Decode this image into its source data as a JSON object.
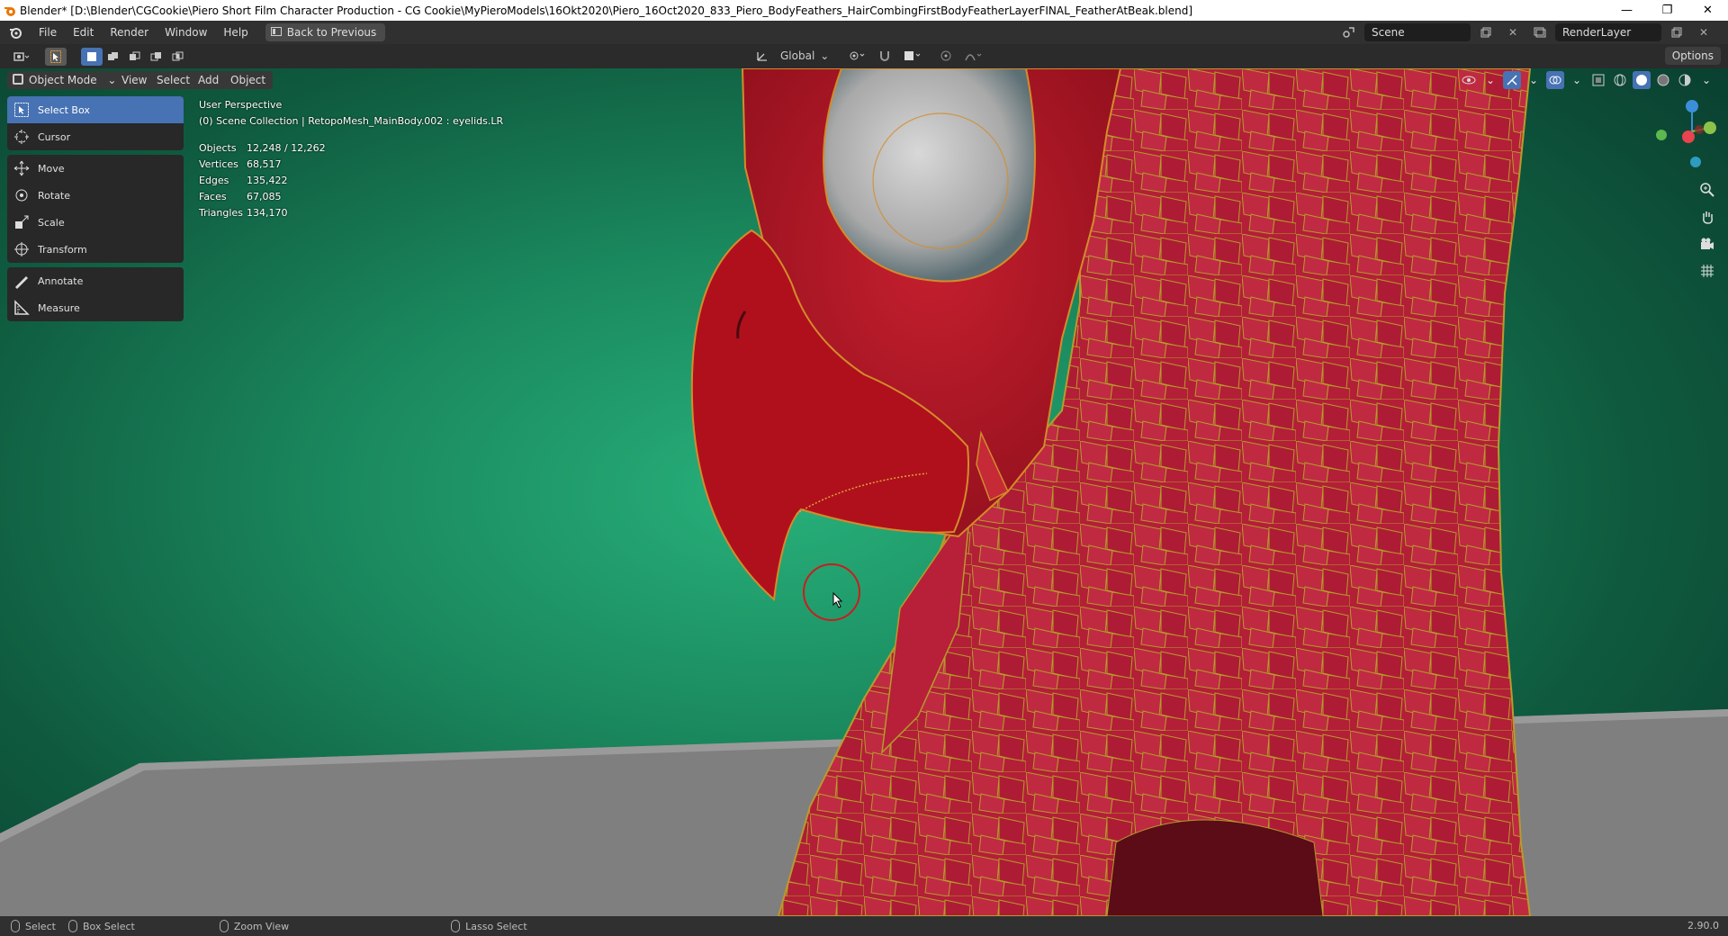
{
  "window": {
    "title": "Blender* [D:\\Blender\\CGCookie\\Piero Short Film Character Production - CG Cookie\\MyPieroModels\\16Okt2020\\Piero_16Oct2020_833_Piero_BodyFeathers_HairCombingFirstBodyFeatherLayerFINAL_FeatherAtBeak.blend]",
    "minimize": "—",
    "restore": "❐",
    "close": "✕"
  },
  "menu": {
    "items": [
      "File",
      "Edit",
      "Render",
      "Window",
      "Help"
    ],
    "back_to_previous": "Back to Previous",
    "scene": "Scene",
    "render_layer": "RenderLayer"
  },
  "header": {
    "orientation": "Global",
    "options": "Options"
  },
  "viewport": {
    "mode": "Object Mode",
    "menus": [
      "View",
      "Select",
      "Add",
      "Object"
    ],
    "perspective": "User Perspective",
    "collection": "(0) Scene Collection | RetopoMesh_MainBody.002 : eyelids.LR",
    "stats": [
      {
        "label": "Objects",
        "value": "12,248 / 12,262"
      },
      {
        "label": "Vertices",
        "value": "68,517"
      },
      {
        "label": "Edges",
        "value": "135,422"
      },
      {
        "label": "Faces",
        "value": "67,085"
      },
      {
        "label": "Triangles",
        "value": "134,170"
      }
    ],
    "gizmo": {
      "x_color": "#e8434f",
      "y_color": "#8bc34a",
      "z_color": "#3b8ed9"
    }
  },
  "toolbar": {
    "groups": [
      [
        {
          "label": "Select Box",
          "icon": "select-box-icon",
          "active": true
        },
        {
          "label": "Cursor",
          "icon": "cursor-icon"
        }
      ],
      [
        {
          "label": "Move",
          "icon": "move-icon"
        },
        {
          "label": "Rotate",
          "icon": "rotate-icon"
        },
        {
          "label": "Scale",
          "icon": "scale-icon"
        },
        {
          "label": "Transform",
          "icon": "transform-icon"
        }
      ],
      [
        {
          "label": "Annotate",
          "icon": "annotate-icon"
        },
        {
          "label": "Measure",
          "icon": "measure-icon"
        }
      ]
    ]
  },
  "statusbar": {
    "select": "Select",
    "box_select": "Box Select",
    "zoom_view": "Zoom View",
    "lasso_select": "Lasso Select",
    "version": "2.90.0"
  },
  "colors": {
    "accent": "#4772b3",
    "feather_red": "#b5203a",
    "selection_outline": "#c9a227"
  }
}
